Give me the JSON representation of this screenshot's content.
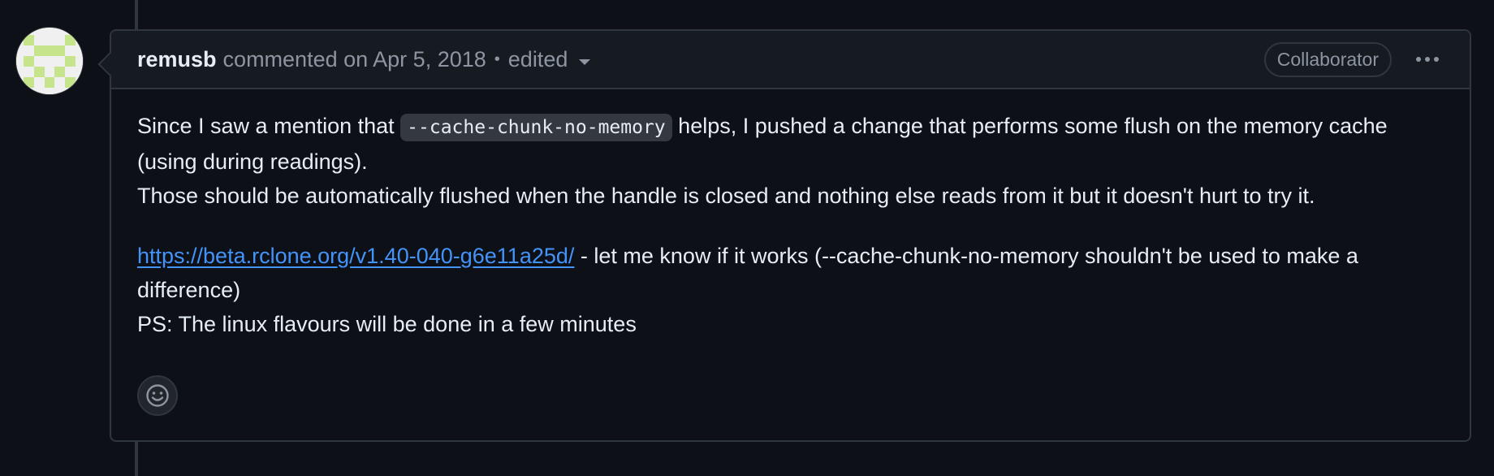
{
  "comment": {
    "author": "remusb",
    "action": "commented on Apr 5, 2018",
    "separator": "•",
    "edited": "edited",
    "role": "Collaborator",
    "body": {
      "p1_before": "Since I saw a mention that ",
      "p1_code": "--cache-chunk-no-memory",
      "p1_after": " helps, I pushed a change that performs some flush on the memory cache (using during readings).",
      "p1_line2": "Those should be automatically flushed when the handle is closed and nothing else reads from it but it doesn't hurt to try it.",
      "p2_link": "https://beta.rclone.org/v1.40-040-g6e11a25d/",
      "p2_after": " - let me know if it works (--cache-chunk-no-memory shouldn't be used to make a difference)",
      "p2_line2": "PS: The linux flavours will be done in a few minutes"
    }
  },
  "icons": {
    "avatar": "identicon-avatar",
    "menu": "kebab-horizontal-icon",
    "reaction": "smiley-icon",
    "caret": "triangle-down-icon"
  },
  "colors": {
    "background": "#0d1117",
    "header": "#161b22",
    "border": "#30363d",
    "link": "#4493f8",
    "muted": "#8d96a0",
    "identicon": "#c6e48b"
  }
}
